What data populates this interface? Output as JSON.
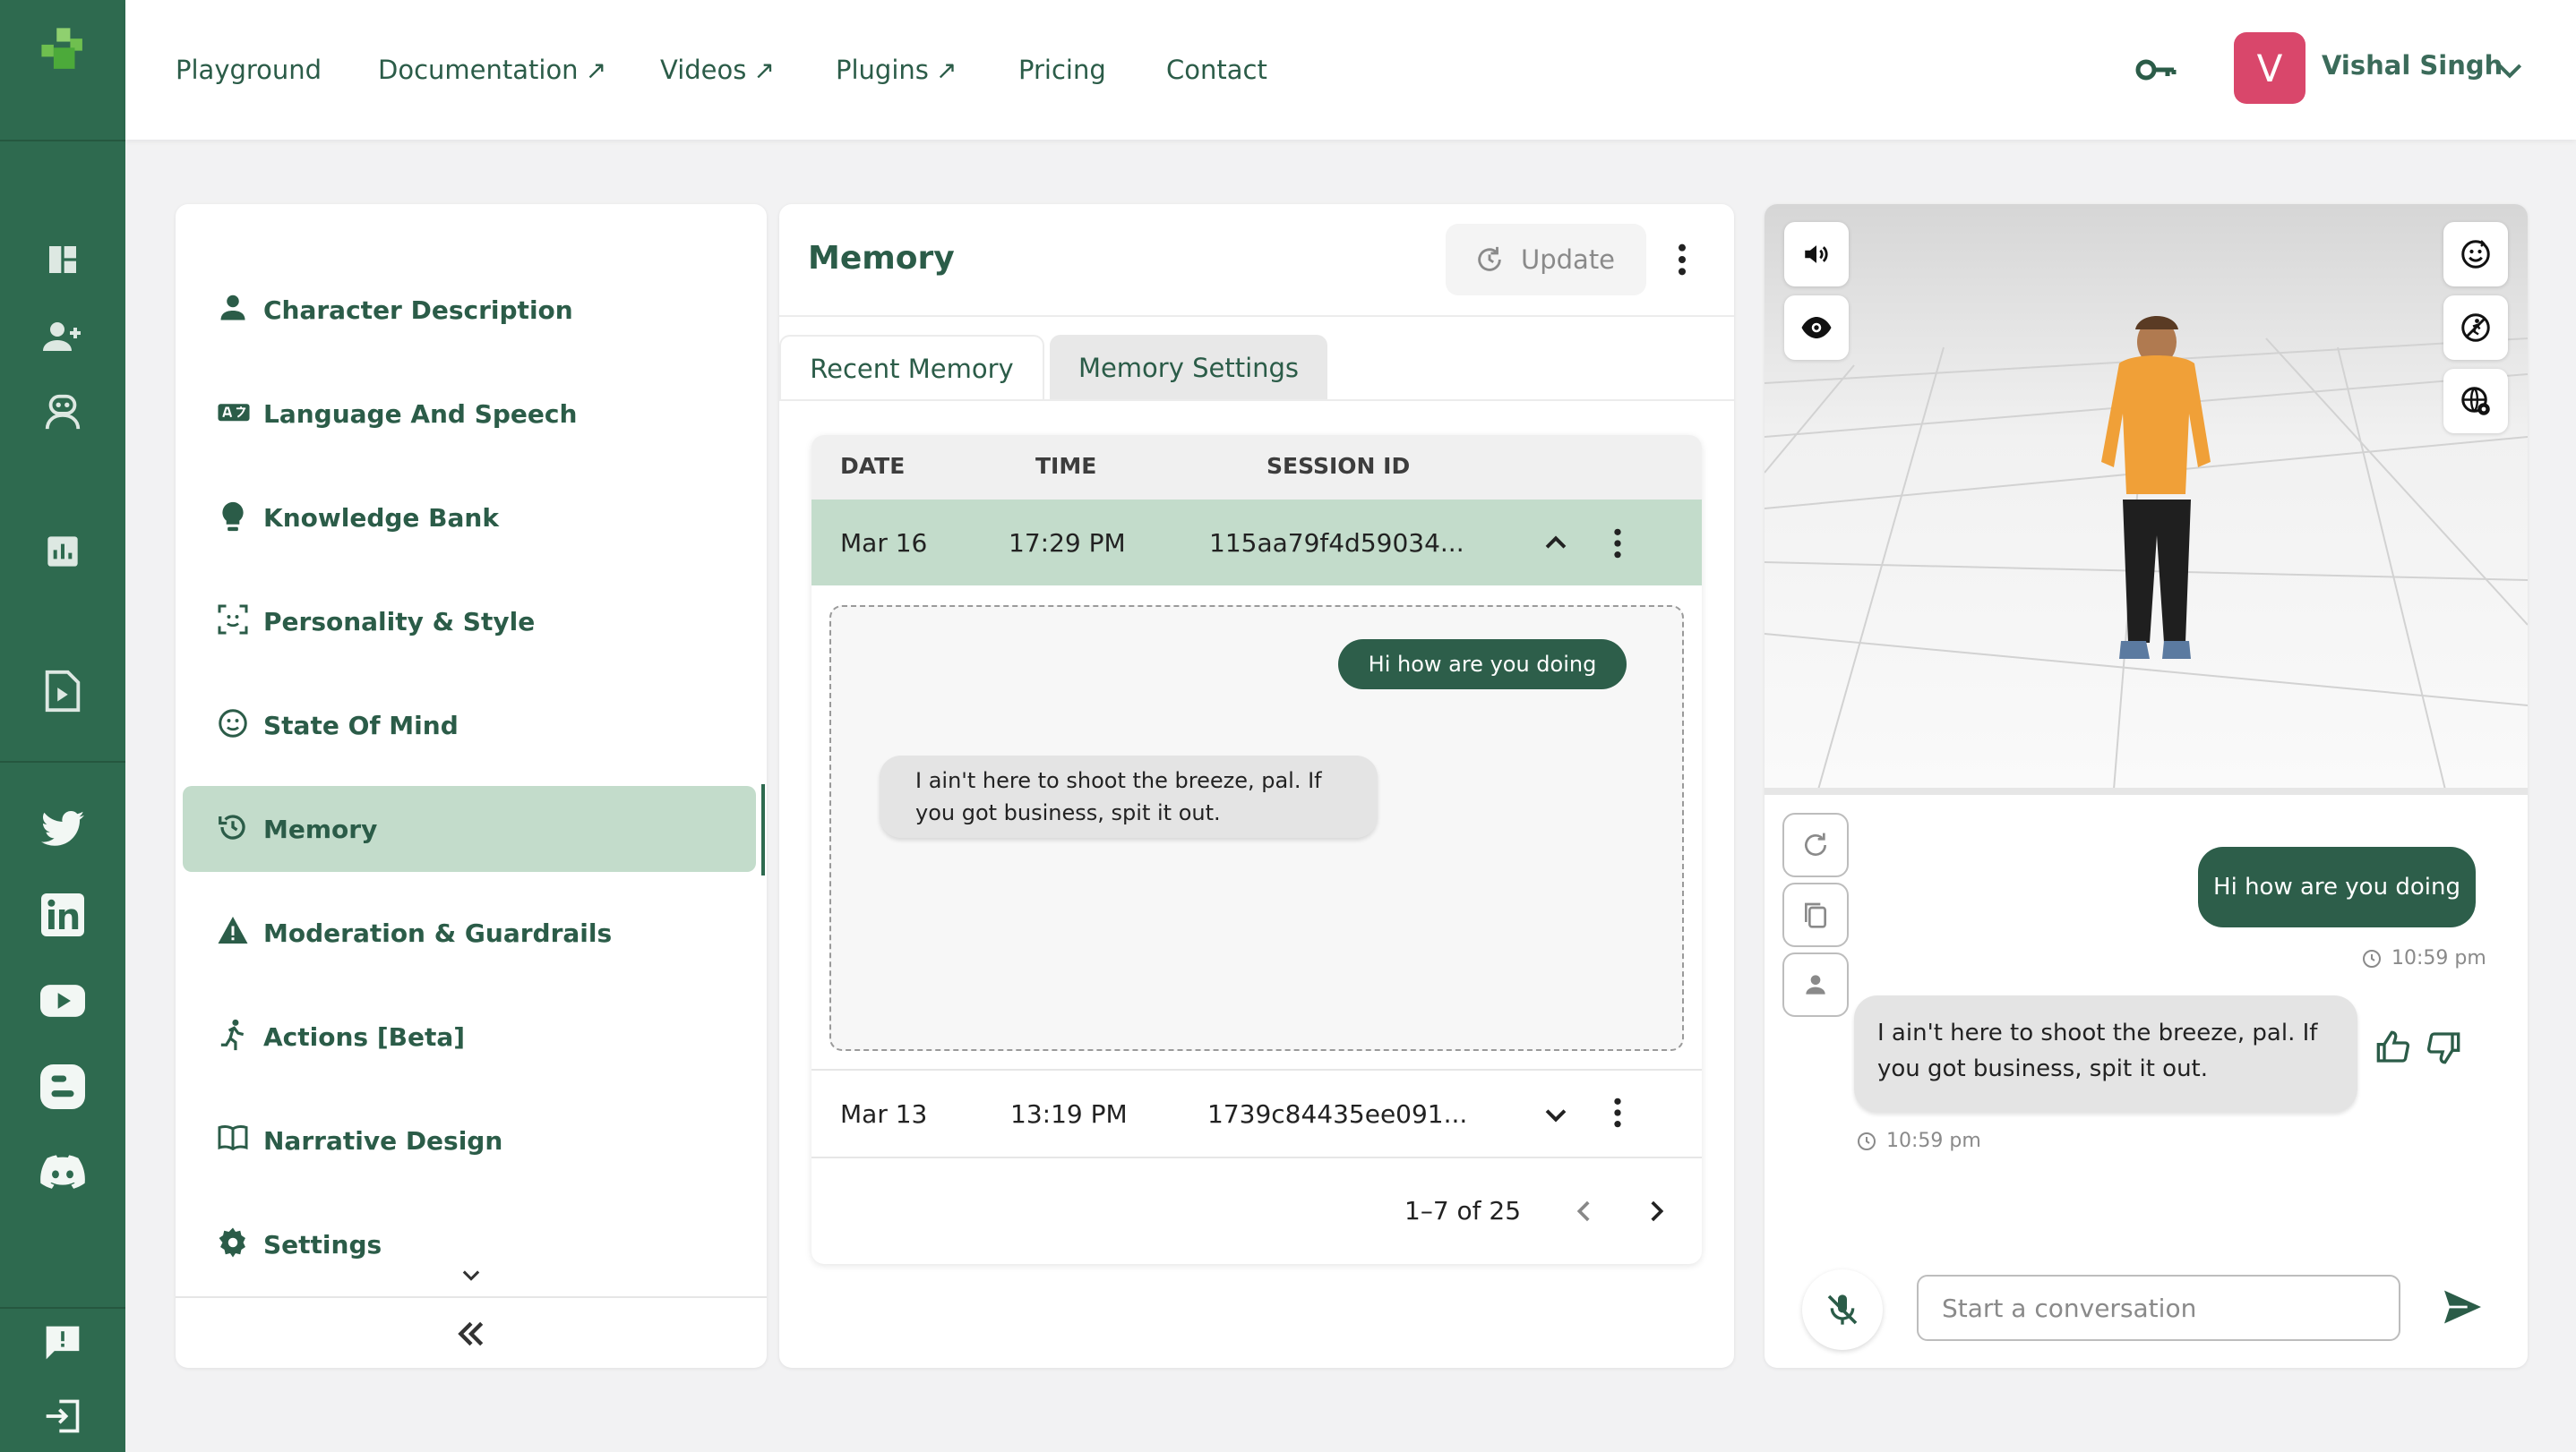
{
  "nav": {
    "items": [
      {
        "label": "Playground",
        "external": false
      },
      {
        "label": "Documentation",
        "external": true
      },
      {
        "label": "Videos",
        "external": true
      },
      {
        "label": "Plugins",
        "external": true
      },
      {
        "label": "Pricing",
        "external": false
      },
      {
        "label": "Contact",
        "external": false
      }
    ],
    "user": {
      "initial": "V",
      "name": "Vishal Singh",
      "avatar_color": "#d9476b"
    }
  },
  "rail": {
    "icons": [
      "logo-icon",
      "dashboard-icon",
      "add-user-icon",
      "character-icon",
      "analytics-icon",
      "video-file-icon",
      "twitter-icon",
      "linkedin-icon",
      "youtube-icon",
      "blogger-icon",
      "discord-icon",
      "feedback-icon",
      "logout-icon"
    ]
  },
  "sidebar": {
    "items": [
      {
        "label": "Character Description",
        "icon": "person-icon"
      },
      {
        "label": "Language And Speech",
        "icon": "translate-icon"
      },
      {
        "label": "Knowledge Bank",
        "icon": "lightbulb-icon"
      },
      {
        "label": "Personality & Style",
        "icon": "face-scan-icon"
      },
      {
        "label": "State Of Mind",
        "icon": "mood-icon"
      },
      {
        "label": "Memory",
        "icon": "history-icon",
        "active": true
      },
      {
        "label": "Moderation & Guardrails",
        "icon": "warning-icon"
      },
      {
        "label": "Actions [Beta]",
        "icon": "running-icon"
      },
      {
        "label": "Narrative Design",
        "icon": "book-icon"
      },
      {
        "label": "Settings",
        "icon": "gear-icon"
      }
    ]
  },
  "memory": {
    "title": "Memory",
    "update_label": "Update",
    "tabs": [
      {
        "label": "Recent Memory",
        "active": true
      },
      {
        "label": "Memory Settings",
        "active": false
      }
    ],
    "columns": [
      "DATE",
      "TIME",
      "SESSION ID"
    ],
    "rows": [
      {
        "date": "Mar 16",
        "time": "17:29 PM",
        "session": "115aa79f4d59034...",
        "expanded": true
      },
      {
        "date": "Mar 13",
        "time": "13:19 PM",
        "session": "1739c84435ee091...",
        "expanded": false
      }
    ],
    "conversation": {
      "user": "Hi how are you doing",
      "bot": "I ain't here to shoot the breeze, pal. If you got business, spit it out."
    },
    "pagination": "1–7 of 25"
  },
  "chat": {
    "messages": [
      {
        "role": "user",
        "text": "Hi how are you doing",
        "time": "10:59 pm"
      },
      {
        "role": "bot",
        "text": "I ain't here to shoot the breeze, pal. If you got business, spit it out.",
        "time": "10:59 pm"
      }
    ],
    "input_placeholder": "Start a conversation"
  },
  "colors": {
    "brand": "#2e6a4f",
    "accent_light": "#c3dccb",
    "bubble_user": "#2d5e4a"
  }
}
